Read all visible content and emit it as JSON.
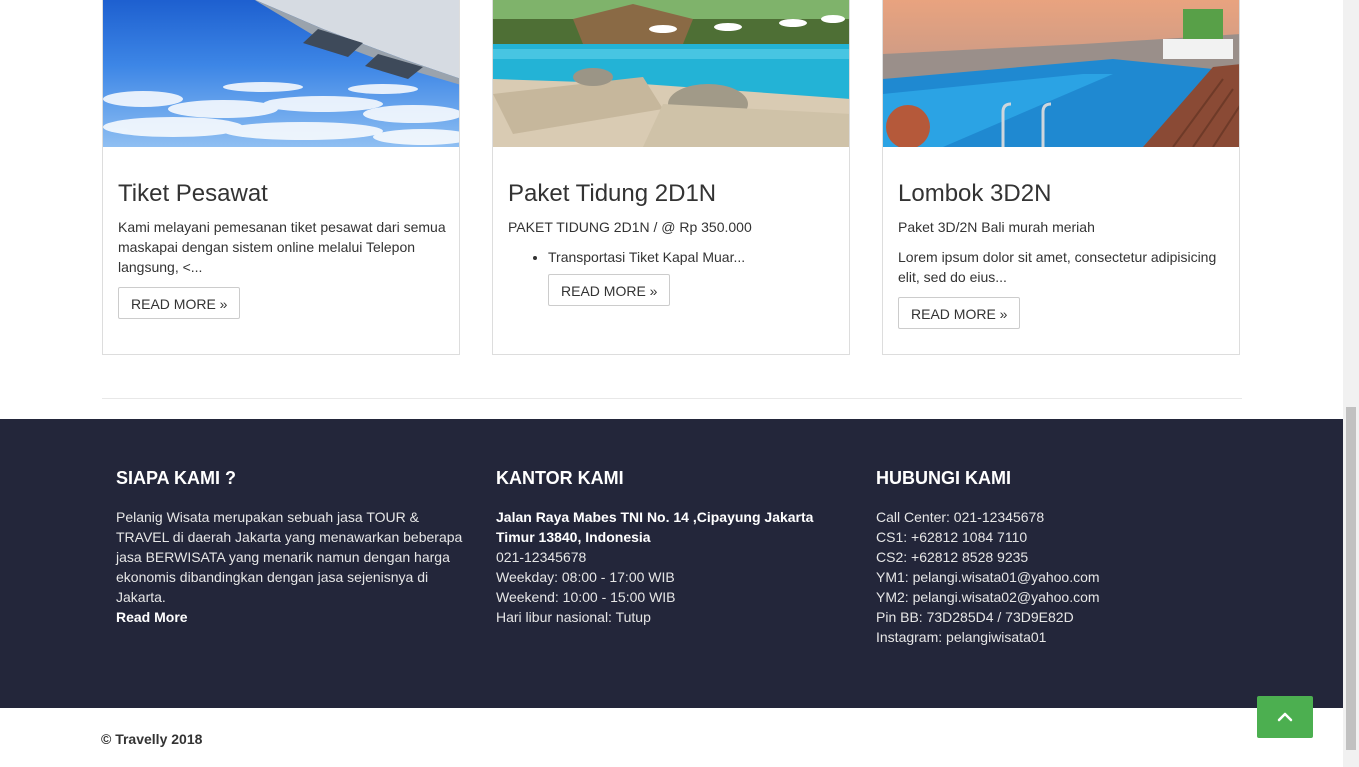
{
  "cards": [
    {
      "title": "Tiket Pesawat",
      "excerpt": "Kami melayani pemesanan tiket pesawat dari semua maskapai dengan sistem online melalui Telepon langsung, <...",
      "button": "READ MORE »"
    },
    {
      "title": "Paket Tidung 2D1N",
      "excerpt": "PAKET TIDUNG 2D1N / @ Rp 350.000",
      "bullet": "Transportasi Tiket Kapal Muar...",
      "button": "READ MORE »"
    },
    {
      "title": "Lombok 3D2N",
      "excerpt": "Paket 3D/2N Bali murah meriah",
      "excerpt2": "Lorem ipsum dolor sit amet, consectetur adipisicing elit, sed do eius...",
      "button": "READ MORE »"
    }
  ],
  "footer": {
    "about": {
      "heading": "SIAPA KAMI ?",
      "text": "Pelanig Wisata merupakan sebuah jasa TOUR & TRAVEL di daerah Jakarta yang menawarkan beberapa jasa BERWISATA yang menarik namun dengan harga ekonomis dibandingkan dengan jasa sejenisnya di Jakarta.",
      "link": "Read More"
    },
    "office": {
      "heading": "KANTOR KAMI",
      "address": "Jalan Raya Mabes TNI No. 14 ,Cipayung Jakarta Timur 13840, Indonesia",
      "lines": [
        "021-12345678",
        "Weekday: 08:00 - 17:00 WIB",
        "Weekend: 10:00 - 15:00 WIB",
        "Hari libur nasional: Tutup"
      ]
    },
    "contact": {
      "heading": "HUBUNGI KAMI",
      "lines": [
        "Call Center: 021-12345678",
        "CS1: +62812 1084 7110",
        "CS2: +62812 8528 9235",
        "YM1: pelangi.wisata01@yahoo.com",
        "YM2: pelangi.wisata02@yahoo.com",
        "Pin BB: 73D285D4 / 73D9E82D",
        "Instagram: pelangiwisata01"
      ]
    },
    "copyright": "© Travelly 2018"
  },
  "icons": {
    "back_to_top": "chevron-up-icon"
  },
  "colors": {
    "footer_bg": "#23263a",
    "back_to_top_bg": "#4caf50"
  }
}
